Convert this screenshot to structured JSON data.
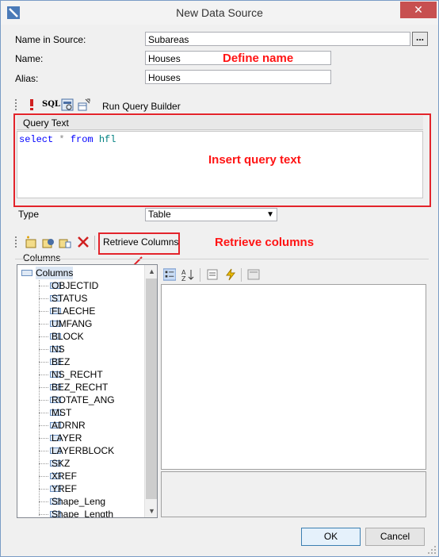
{
  "window": {
    "title": "New Data Source",
    "close_glyph": "✕"
  },
  "form": {
    "name_in_source_label": "Name in Source:",
    "name_in_source_value": "Subareas",
    "browse_label": "...",
    "name_label": "Name:",
    "name_value": "Houses",
    "alias_label": "Alias:",
    "alias_value": "Houses"
  },
  "query_toolbar": {
    "icons": [
      "exclamation-icon",
      "sql-icon",
      "query-designer-icon",
      "add-table-icon"
    ],
    "sql_label": "SQL",
    "run_query_builder": "Run Query Builder"
  },
  "query": {
    "header": "Query Text",
    "keyword_select": "select",
    "star": "*",
    "keyword_from": "from",
    "table": "hfl"
  },
  "type": {
    "label": "Type",
    "value": "Table"
  },
  "columns_toolbar": {
    "icons": [
      "new-column-icon",
      "edit-column-icon",
      "calc-column-icon",
      "delete-icon"
    ],
    "retrieve_label": "Retrieve Columns"
  },
  "columns": {
    "group_label": "Columns",
    "root": "Columns",
    "items": [
      "OBJECTID",
      "STATUS",
      "FLAECHE",
      "UMFANG",
      "BLOCK",
      "NS",
      "BEZ",
      "NS_RECHT",
      "BEZ_RECHT",
      "ROTATE_ANG",
      "MST",
      "ADRNR",
      "LAYER",
      "LAYERBLOCK",
      "SKZ",
      "XREF",
      "YREF",
      "Shape_Leng",
      "Shape_Length"
    ]
  },
  "property_toolbar": {
    "icons": [
      "categorized-icon",
      "alphabetical-icon",
      "properties-icon",
      "events-icon",
      "property-pages-icon"
    ]
  },
  "annotations": {
    "define_name": "Define name",
    "insert_query": "Insert query text",
    "retrieve_columns": "Retrieve columns"
  },
  "buttons": {
    "ok": "OK",
    "cancel": "Cancel"
  },
  "colors": {
    "annotation": "#ff1414",
    "title_close_bg": "#c75050",
    "sql_keyword": "#0000ff"
  }
}
